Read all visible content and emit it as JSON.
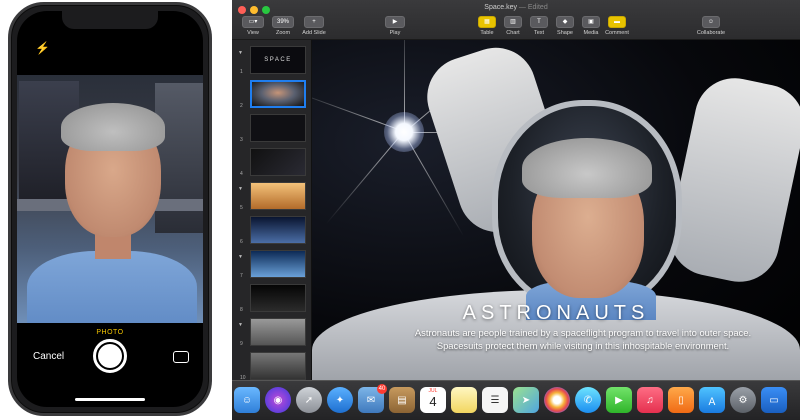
{
  "iphone": {
    "flash_icon": "⚡",
    "mode_label": "PHOTO",
    "cancel_label": "Cancel"
  },
  "window": {
    "title": "Space.key",
    "subtitle": "— Edited"
  },
  "toolbar": {
    "view_label": "View",
    "zoom_value": "39%",
    "zoom_label": "Zoom",
    "add_slide_label": "Add Slide",
    "play_label": "Play",
    "table_label": "Table",
    "chart_label": "Chart",
    "text_label": "Text",
    "shape_label": "Shape",
    "media_label": "Media",
    "comment_label": "Comment",
    "collaborate_label": "Collaborate"
  },
  "navigator": {
    "slides": [
      {
        "num": "1",
        "title": "SPACE"
      },
      {
        "num": "2",
        "title": ""
      },
      {
        "num": "3",
        "title": ""
      },
      {
        "num": "4",
        "title": ""
      },
      {
        "num": "5",
        "title": ""
      },
      {
        "num": "6",
        "title": ""
      },
      {
        "num": "7",
        "title": ""
      },
      {
        "num": "8",
        "title": ""
      },
      {
        "num": "9",
        "title": ""
      },
      {
        "num": "10",
        "title": ""
      }
    ]
  },
  "slide": {
    "title": "ASTRONAUTS",
    "body_line1": "Astronauts are people trained by a spaceflight program to travel into outer space.",
    "body_line2": "Spacesuits protect them while visiting in this inhospitable environment."
  },
  "dock": {
    "mail_badge": "40",
    "calendar_month": "JUL",
    "calendar_day": "4"
  },
  "colors": {
    "selection_blue": "#1f7ef0",
    "accent_yellow": "#e8c300",
    "camera_mode_yellow": "#f3c400",
    "badge_red": "#ff3b30"
  }
}
